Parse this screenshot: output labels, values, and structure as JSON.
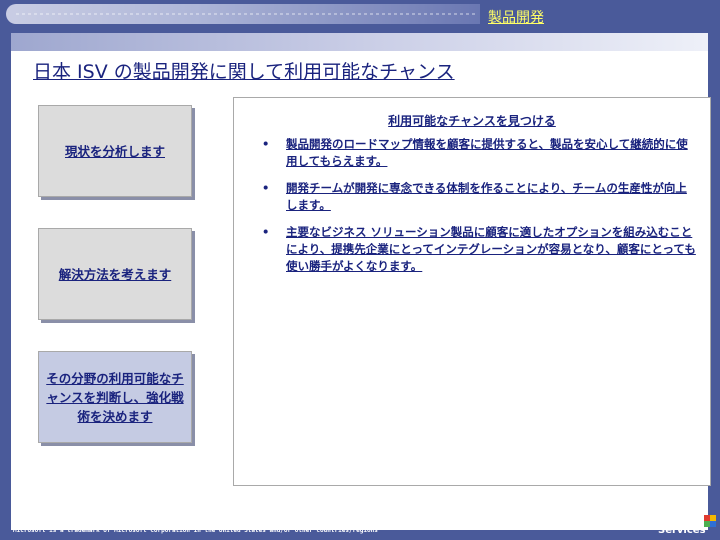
{
  "header": {
    "section_title": "製品開発"
  },
  "main": {
    "page_title": "日本 ISV の製品開発に関して利用可能なチャンス",
    "steps": [
      {
        "label": "現状を分析します"
      },
      {
        "label": "解決方法を考えます"
      },
      {
        "label": "その分野の利用可能なチャンスを判断し、強化戦術を決めます"
      }
    ],
    "opportunities": {
      "heading": "利用可能なチャンスを見つける",
      "bullet_glyph": "•",
      "items": [
        "製品開発のロードマップ情報を顧客に提供すると、製品を安心して継続的に使用してもらえます。",
        "開発チームが開発に専念できる体制を作ることにより、チームの生産性が向上します。",
        "主要なビジネス ソリューション製品に顧客に適したオプションを組み込むことにより、提携先企業にとってインテグレーションが容易となり、顧客にとっても使い勝手がよくなります。"
      ]
    }
  },
  "footer": {
    "copyright_line1": "Copyright © 2003 Microsoft Corporation. ALL RIGHTS RESERVED",
    "copyright_line2": "Microsoft is a trademark of Microsoft Corporation in the United States and/or other countries/regions",
    "logo_line1": "Global",
    "logo_line2": "Learning",
    "logo_line3": "Services",
    "logo_colors": [
      "#e03a2f",
      "#f5b800",
      "#4caf50",
      "#2f6fd6"
    ]
  },
  "colors": {
    "background": "#4a5a9a",
    "title_text": "#1a237e",
    "section_title": "#ffff66"
  }
}
